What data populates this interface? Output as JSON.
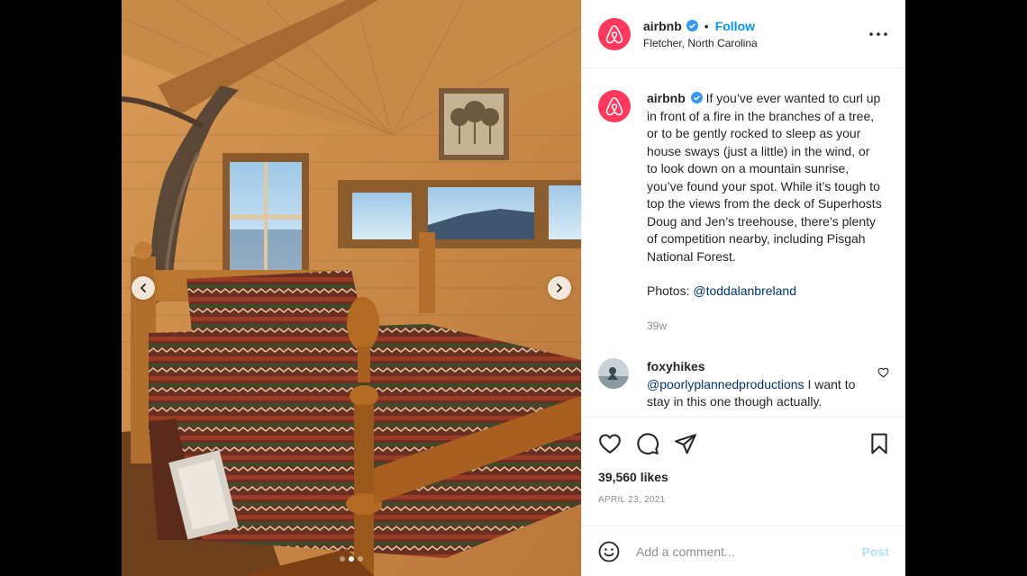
{
  "post": {
    "account": "airbnb",
    "follow_label": "Follow",
    "location": "Fletcher, North Carolina",
    "caption": "If you’ve ever wanted to curl up in front of a fire in the branches of a tree, or to be gently rocked to sleep as your house sways (just a little) in the wind, or to look down on a mountain sunrise, you’ve found your spot. While it’s tough to top the views from the deck of Superhosts Doug and Jen’s treehouse, there’s plenty of competition nearby, including Pisgah National Forest.",
    "photos_prefix": "Photos: ",
    "photos_mention": "@toddalanbreland",
    "age": "39w",
    "likes": "39,560 likes",
    "date": "APRIL 23, 2021",
    "carousel": {
      "slide_count": 3,
      "active_index": 1
    }
  },
  "comments": [
    {
      "user": "foxyhikes",
      "mention": "@poorlyplannedproductions",
      "text": " I want to stay in this one though actually."
    }
  ],
  "comment_box": {
    "placeholder": "Add a comment...",
    "post_label": "Post"
  },
  "icons": [
    "airbnb-logo-icon",
    "verified-icon",
    "more-options-icon",
    "chevron-left-icon",
    "chevron-right-icon",
    "heart-icon",
    "comment-icon",
    "share-icon",
    "bookmark-icon",
    "emoji-icon"
  ],
  "colors": {
    "brand": "#ff385c",
    "link": "#0095f6",
    "mention": "#00376b",
    "verified": "#3897f0",
    "post_disabled": "#b2dffc"
  }
}
